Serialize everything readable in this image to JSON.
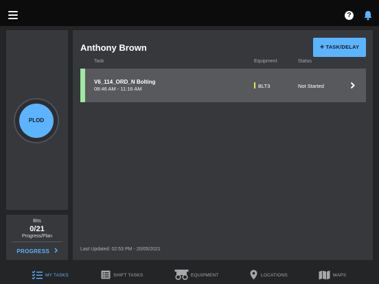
{
  "header": {
    "menu_icon": "hamburger-menu-icon",
    "help_icon": "help-icon",
    "help_glyph": "?",
    "notifications_icon": "bell-icon"
  },
  "plod": {
    "label": "PLOD"
  },
  "stats": {
    "title": "Bits",
    "value": "0/21",
    "subtitle": "Progress/Plan",
    "progress_label": "PROGRESS"
  },
  "main": {
    "operator_name": "Anthony Brown",
    "add_button_label": "TASK/DELAY",
    "columns": {
      "task": "Task",
      "equipment": "Equipment",
      "status": "Status"
    },
    "tasks": [
      {
        "name": "V6_114_ORD_N Bolting",
        "time": "08:46 AM - 11:16 AM",
        "equipment": "BLT3",
        "status": "Not Started"
      }
    ],
    "last_updated": "Last Updated: 02:53 PM - 20/05/2021"
  },
  "nav": {
    "items": [
      {
        "label": "MY TASKS",
        "icon": "checklist-icon",
        "active": true
      },
      {
        "label": "SHIFT TASKS",
        "icon": "list-box-icon",
        "active": false
      },
      {
        "label": "EQUIPMENT",
        "icon": "drill-rig-icon",
        "active": false
      },
      {
        "label": "LOCATIONS",
        "icon": "map-pin-icon",
        "active": false
      },
      {
        "label": "MAPS",
        "icon": "folded-map-icon",
        "active": false
      }
    ]
  },
  "colors": {
    "accent": "#5cb3ff",
    "row_accent": "#9fe89f",
    "equipment_marker": "#e6e65c"
  }
}
